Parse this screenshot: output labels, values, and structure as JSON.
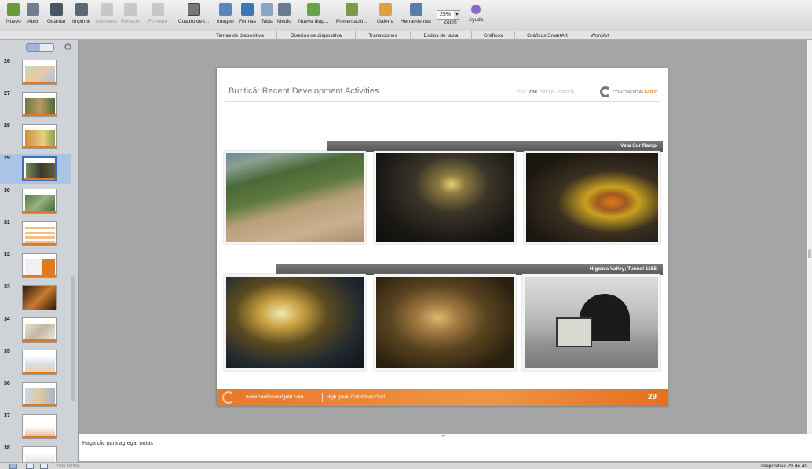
{
  "toolbar": {
    "buttons": [
      {
        "label": "Nuevo",
        "icon": "new-document-icon"
      },
      {
        "label": "Abrir",
        "icon": "open-folder-icon"
      },
      {
        "label": "Guardar",
        "icon": "save-disk-icon"
      },
      {
        "label": "Imprimir",
        "icon": "printer-icon"
      },
      {
        "label": "Deshacer",
        "icon": "undo-icon"
      },
      {
        "label": "Rehacer",
        "icon": "redo-icon"
      },
      {
        "label": "Formato",
        "icon": "format-brush-icon"
      },
      {
        "label": "Cuadro de t...",
        "icon": "text-box-icon"
      },
      {
        "label": "Imagen",
        "icon": "image-icon"
      },
      {
        "label": "Formas",
        "icon": "shapes-icon"
      },
      {
        "label": "Tabla",
        "icon": "table-icon"
      },
      {
        "label": "Medio",
        "icon": "media-icon"
      },
      {
        "label": "Nueva diap...",
        "icon": "new-slide-icon"
      },
      {
        "label": "Presentació...",
        "icon": "slideshow-icon"
      },
      {
        "label": "Galería",
        "icon": "gallery-icon"
      },
      {
        "label": "Herramientas",
        "icon": "toolbox-icon"
      },
      {
        "label": "Zoom",
        "icon": "zoom-icon"
      },
      {
        "label": "Ayuda",
        "icon": "help-icon"
      }
    ],
    "zoom_value": "25%"
  },
  "ribbon": {
    "tabs": [
      "Temas de diapositiva",
      "Diseños de diapositiva",
      "Transiciones",
      "Estilos de tabla",
      "Gráficos",
      "Gráficos SmartArt",
      "WordArt"
    ]
  },
  "sidebar": {
    "thumbnails": [
      "26",
      "27",
      "28",
      "29",
      "30",
      "31",
      "32",
      "33",
      "34",
      "35",
      "36",
      "37",
      "38"
    ],
    "selected": "29"
  },
  "slide": {
    "title": "Buriticá: Recent Development Activities",
    "ticker": {
      "prefix": "TSX :",
      "cnl": "CNL",
      "rest": "OTCQX : CGOOF"
    },
    "logo": {
      "name": "CONTINENTAL",
      "accent": "GOLD"
    },
    "band1": {
      "underlined": "Veta",
      "rest": " Sur Ramp"
    },
    "band2": {
      "label": "Higabra Valley; Tunnel 1155"
    },
    "footer": {
      "url": "www.continentalgold.com",
      "tagline": "High grade Colombian Gold"
    },
    "number": "29"
  },
  "notes": {
    "placeholder": "Haga clic para agregar notas"
  },
  "status": {
    "left": "Vista normal",
    "right": "Diapositiva 29 de 49"
  },
  "colors": {
    "accent_orange": "#e07a1f",
    "selection_blue": "#aac4e8",
    "band_gray": "#666666"
  }
}
